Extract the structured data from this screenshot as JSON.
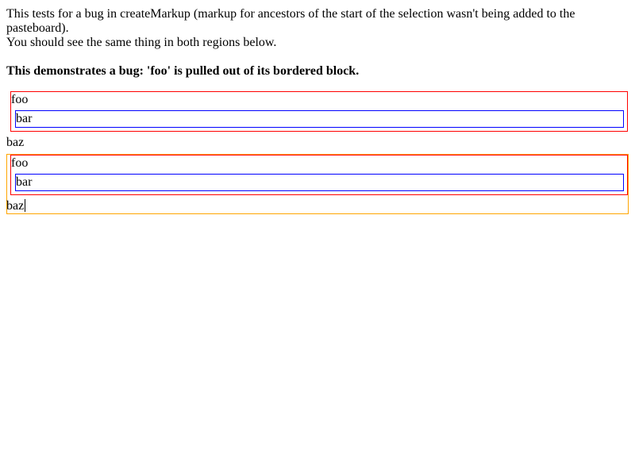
{
  "intro": {
    "line1": "This tests for a bug in createMarkup (markup for ancestors of the start of the selection wasn't being added to the pasteboard).",
    "line2": "You should see the same thing in both regions below."
  },
  "heading": "This demonstrates a bug: 'foo' is pulled out of its bordered block.",
  "region_original": {
    "outer_text": "foo",
    "inner_text": "bar",
    "after_text": "baz"
  },
  "region_pasted": {
    "outer_text": "foo",
    "inner_text": "bar",
    "after_text": "baz"
  },
  "colors": {
    "outer_border": "#ff0000",
    "inner_border": "#0000ff",
    "editable_border": "#ffa500"
  }
}
